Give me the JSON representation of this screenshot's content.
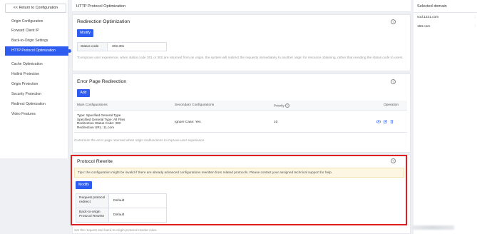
{
  "sidebar": {
    "return_label": "<< Return to Configuration",
    "items": [
      {
        "label": "Origin Configuration"
      },
      {
        "label": "Forward Client IP"
      },
      {
        "label": "Back-to-Origin Settings"
      },
      {
        "label": "HTTP Protocol Optimization"
      },
      {
        "label": "Cache Optimization"
      },
      {
        "label": "Hotlink Protection"
      },
      {
        "label": "Origin Protection"
      },
      {
        "label": "Security Protection"
      },
      {
        "label": "Redirect Optimization"
      },
      {
        "label": "Video Features"
      }
    ],
    "active_index": 3
  },
  "page": {
    "title": "HTTP Protocol Optimization"
  },
  "redirection": {
    "title": "Redirection Optimization",
    "modify_label": "Modify",
    "status_key": "Status code",
    "status_value": "302,301",
    "description": "To improve user experience, when status code 301 or 302 are returned from an origin, the system will redirect the requests immediately to another origin for resource obtaining, rather than sending the status code to users."
  },
  "error_page": {
    "title": "Error Page Redirection",
    "add_label": "Add",
    "columns": {
      "main": "Main Configurations",
      "secondary": "Secondary Configurations",
      "priority": "Priority",
      "operation": "Operation"
    },
    "row": {
      "main_lines": [
        "Type: Specified General Type",
        "Specified General Type: All Files",
        "Redirection Status Code: 300",
        "Redirection URL: 11.com"
      ],
      "secondary": "Ignore Case: Yes",
      "priority": "10"
    },
    "description": "Customize the error page returned when origin malfunctions to improve user experience."
  },
  "protocol_rewrite": {
    "title": "Protocol Rewrite",
    "tip": "Tips: the configuration might be invalid if there are already advanced configurations rewritten from related protocols. Please contact your assigned technical support for help.",
    "modify_label": "Modify",
    "rows": [
      {
        "key": "Request protocol redirect",
        "value": "Default"
      },
      {
        "key": "Back-to-origin Protocol Rewrite",
        "value": "Default"
      }
    ],
    "description": "Set the request and back-to-origin protocol rewrite rules."
  },
  "domains": {
    "title": "Selected domain",
    "items": [
      "vod.1231.com",
      "163.com"
    ]
  },
  "colors": {
    "accent": "#2e5cf0",
    "highlight_border": "#e02020",
    "tip_background": "#fdf6e3"
  },
  "icons": [
    "help-icon",
    "view-icon",
    "edit-icon",
    "delete-icon",
    "priority-help-icon"
  ]
}
